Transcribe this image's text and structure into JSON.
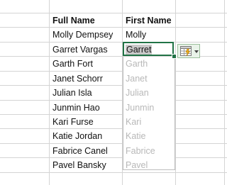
{
  "headers": {
    "full_name": "Full Name",
    "first_name": "First Name"
  },
  "rows": [
    {
      "full": "Molly Dempsey",
      "first": "Molly"
    },
    {
      "full": "Garret Vargas",
      "first": "Garret"
    },
    {
      "full": "Garth Fort",
      "first": "Garth"
    },
    {
      "full": "Janet Schorr",
      "first": "Janet"
    },
    {
      "full": "Julian Isla",
      "first": "Julian"
    },
    {
      "full": "Junmin Hao",
      "first": "Junmin"
    },
    {
      "full": "Kari Furse",
      "first": "Kari"
    },
    {
      "full": "Katie Jordan",
      "first": "Katie"
    },
    {
      "full": "Fabrice Canel",
      "first": "Fabrice"
    },
    {
      "full": "Pavel Bansky",
      "first": "Pavel"
    }
  ],
  "flash_fill": {
    "icon": "flash-fill-options-icon",
    "arrow_icon": "chevron-down-icon"
  },
  "colors": {
    "accent": "#217346",
    "preview_text": "#b8b8b8",
    "grid": "#d4d4d4"
  }
}
